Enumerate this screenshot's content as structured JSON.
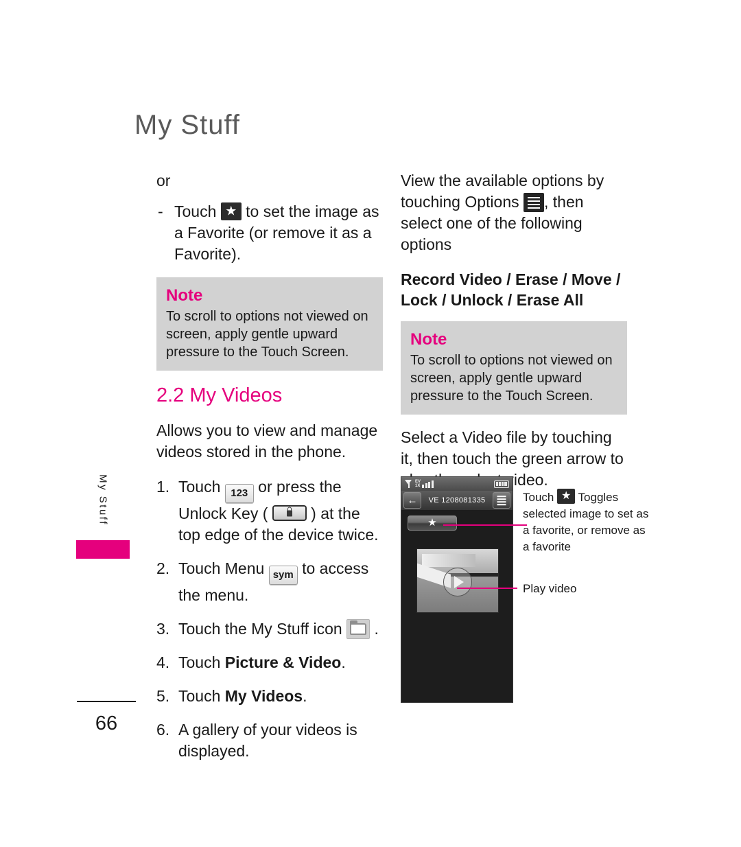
{
  "page": {
    "title": "My Stuff",
    "number": "66",
    "side_tab_label": "My Stuff",
    "accent_color": "#e5007d",
    "note_bg_color": "#d2d2d2"
  },
  "left_column": {
    "or_text": "or",
    "bullet_dash_marker": "-",
    "bullet_touch_prefix": "Touch",
    "bullet_touch_suffix": "to set the image as a Favorite (or remove it as a Favorite).",
    "star_icon_name": "favorite-star-icon",
    "note": {
      "title": "Note",
      "body": "To scroll to options not viewed on screen, apply gentle upward pressure to the Touch Screen."
    },
    "section_heading": "2.2 My Videos",
    "intro": "Allows you to view and manage videos stored in the phone.",
    "steps": [
      {
        "marker": "1.",
        "prefix": "Touch",
        "key_label": "123",
        "middle": "or press the Unlock Key (",
        "suffix": ") at the top edge of the device twice."
      },
      {
        "marker": "2.",
        "prefix": "Touch Menu",
        "key_label": "sym",
        "suffix": "to access the menu."
      },
      {
        "marker": "3.",
        "prefix": "Touch the My Stuff icon",
        "suffix": "."
      },
      {
        "marker": "4.",
        "prefix": "Touch",
        "bold": "Picture & Video",
        "suffix": "."
      },
      {
        "marker": "5.",
        "prefix": "Touch",
        "bold": "My Videos",
        "suffix": "."
      },
      {
        "marker": "6.",
        "prefix": "A gallery of your videos is displayed."
      }
    ]
  },
  "right_column": {
    "options_intro_prefix": "View the available options by touching Options",
    "options_intro_suffix": ", then select one of the following options",
    "options_list": "Record Video / Erase / Move / Lock / Unlock / Erase All",
    "note": {
      "title": "Note",
      "body": "To scroll to options not viewed on screen, apply gentle upward pressure to the Touch Screen."
    },
    "select_text": "Select a Video file by touching it, then touch the green arrow to play the select video."
  },
  "phone": {
    "statusbar": {
      "antenna_icon": "antenna-icon",
      "network_line1": "EV",
      "network_line2": "1X",
      "signal_bars": 4,
      "battery_icon": "battery-icon",
      "battery_level": 4
    },
    "titlebar": {
      "back_icon": "back-arrow-icon",
      "title": "VE  1208081335",
      "menu_icon": "options-list-icon"
    },
    "favorite_button_icon": "favorite-star-icon",
    "thumbnail_play_icon": "play-icon"
  },
  "callouts": [
    {
      "id": "favorite-callout",
      "text_prefix": "Touch",
      "text_suffix": "Toggles selected image to set as a favorite, or remove as a favorite",
      "icon": "favorite-star-icon"
    },
    {
      "id": "play-callout",
      "text": "Play video"
    }
  ]
}
